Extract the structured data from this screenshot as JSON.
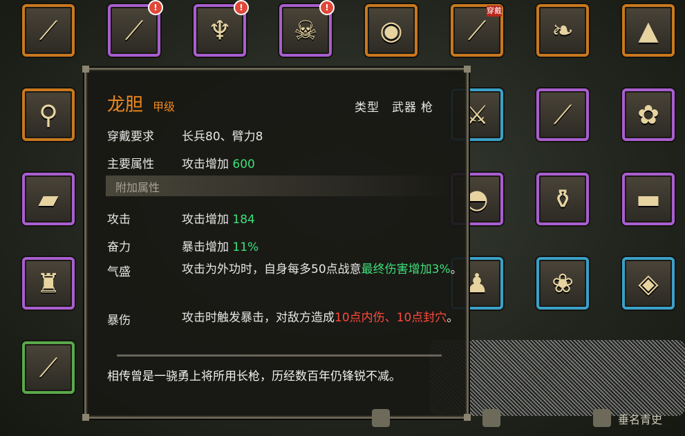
{
  "tooltip": {
    "item_name": "龙胆",
    "grade": "甲级",
    "type_label": "类型",
    "type_value_1": "武器",
    "type_value_2": "枪",
    "requirement_label": "穿戴要求",
    "requirement_value": "长兵80、臂力8",
    "main_attr_label": "主要属性",
    "main_attr_text": "攻击增加",
    "main_attr_value": "600",
    "extra_section": "附加属性",
    "attrs": [
      {
        "label": "攻击",
        "text": "攻击增加",
        "value": "184"
      },
      {
        "label": "奋力",
        "text": "暴击增加",
        "value": "11%"
      }
    ],
    "effect1_label": "气盛",
    "effect1_text": "攻击为外功时，自身每多50点战意",
    "effect1_highlight": "最终伤害增加3%",
    "effect1_tail": "。",
    "effect2_label": "暴伤",
    "effect2_text": "攻击时触发暴击，对敌方造成",
    "effect2_highlight": "10点内伤、10点封穴",
    "effect2_tail": "。",
    "description": "相传曾是一骁勇上将所用长枪，历经数百年仍锋锐不减。"
  },
  "slots": [
    {
      "icon": "spear-icon",
      "glyph": "⟋",
      "rarity": "orange"
    },
    {
      "icon": "staff-icon",
      "glyph": "⟋",
      "rarity": "purple",
      "badge": "!"
    },
    {
      "icon": "horn-icon",
      "glyph": "♆",
      "rarity": "purple",
      "badge": "!"
    },
    {
      "icon": "skull-icon",
      "glyph": "☠",
      "rarity": "purple",
      "badge": "!"
    },
    {
      "icon": "shield-icon",
      "glyph": "◉",
      "rarity": "orange"
    },
    {
      "icon": "jeweled-spear-icon",
      "glyph": "⟋",
      "rarity": "orange",
      "equipped": "穿戴"
    },
    {
      "icon": "tooth-icon",
      "glyph": "❧",
      "rarity": "orange"
    },
    {
      "icon": "cloak-icon",
      "glyph": "▲",
      "rarity": "orange"
    }
  ],
  "bottom": {
    "item3_label": "垂名青史"
  },
  "colors": {
    "orange": "#c8781e",
    "purple": "#a85ed0",
    "blue": "#3aa0c8",
    "green": "#5aa84a",
    "title": "#f08a1e",
    "highlight_green": "#3ee07a",
    "highlight_red": "#ff4a3a"
  }
}
